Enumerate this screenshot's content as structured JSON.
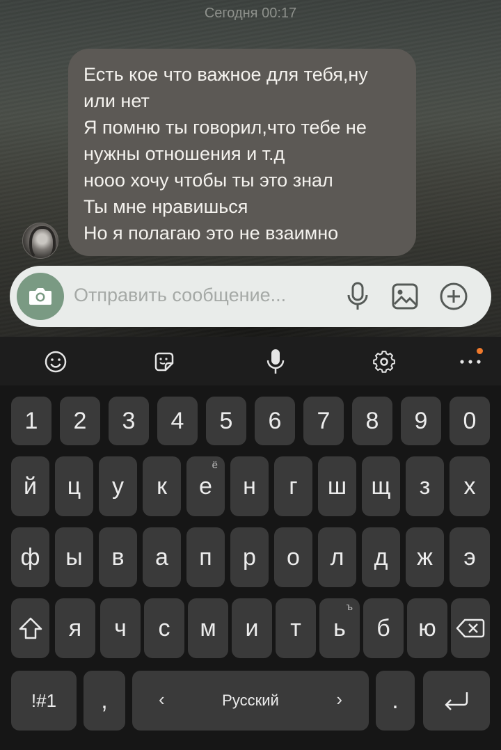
{
  "chat": {
    "timestamp": "Сегодня 00:17",
    "message_lines": [
      "Есть кое что важное для тебя,ну",
      "или нет",
      "Я помню ты говорил,что тебе не",
      "нужны отношения и т.д",
      "нооо хочу чтобы ты это знал",
      "Ты мне нравишься",
      "Но я полагаю это не взаимно"
    ]
  },
  "input": {
    "placeholder": "Отправить сообщение...",
    "icons": [
      "camera-icon",
      "microphone-icon",
      "image-icon",
      "plus-circle-icon"
    ]
  },
  "keyboard": {
    "toolbar_icons": [
      "emoji-icon",
      "sticker-icon",
      "voice-input-icon",
      "settings-icon",
      "more-icon"
    ],
    "row_numbers": [
      "1",
      "2",
      "3",
      "4",
      "5",
      "6",
      "7",
      "8",
      "9",
      "0"
    ],
    "row1": [
      {
        "k": "й"
      },
      {
        "k": "ц"
      },
      {
        "k": "у"
      },
      {
        "k": "к"
      },
      {
        "k": "е",
        "sup": "ё"
      },
      {
        "k": "н"
      },
      {
        "k": "г"
      },
      {
        "k": "ш"
      },
      {
        "k": "щ"
      },
      {
        "k": "з"
      },
      {
        "k": "х"
      }
    ],
    "row2": [
      "ф",
      "ы",
      "в",
      "а",
      "п",
      "р",
      "о",
      "л",
      "д",
      "ж",
      "э"
    ],
    "row3": [
      {
        "k": "я"
      },
      {
        "k": "ч"
      },
      {
        "k": "с"
      },
      {
        "k": "м"
      },
      {
        "k": "и"
      },
      {
        "k": "т"
      },
      {
        "k": "ь",
        "sup": "ъ"
      },
      {
        "k": "б"
      },
      {
        "k": "ю"
      }
    ],
    "symbols_label": "!#1",
    "comma_label": ",",
    "space_label": "Русский",
    "period_label": ".",
    "accent_color": "#f07a2c"
  }
}
